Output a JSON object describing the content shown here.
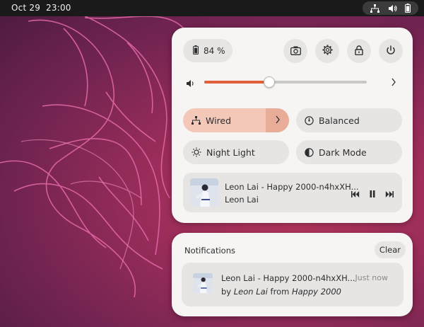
{
  "topbar": {
    "date": "Oct 29",
    "time": "23:00",
    "tray_icons": [
      "network-wired-icon",
      "volume-icon",
      "battery-icon"
    ]
  },
  "quick_settings": {
    "battery_label": "84 %",
    "buttons": [
      "screenshot-icon",
      "settings-icon",
      "lock-icon",
      "power-icon"
    ],
    "volume": {
      "level": 0.4,
      "accent": "#e0603a"
    },
    "toggles": {
      "wired": {
        "label": "Wired",
        "active": true
      },
      "power_mode": {
        "label": "Balanced"
      },
      "night_light": {
        "label": "Night Light"
      },
      "dark_mode": {
        "label": "Dark Mode"
      }
    },
    "media": {
      "title": "Leon Lai - Happy 2000-n4hxXH...",
      "artist": "Leon Lai"
    }
  },
  "notifications": {
    "header": "Notifications",
    "clear_label": "Clear",
    "items": [
      {
        "title": "Leon Lai - Happy 2000-n4hxXH...",
        "time": "Just now",
        "by_prefix": "by",
        "artist": "Leon Lai",
        "from_word": "from",
        "album": "Happy 2000"
      }
    ]
  }
}
